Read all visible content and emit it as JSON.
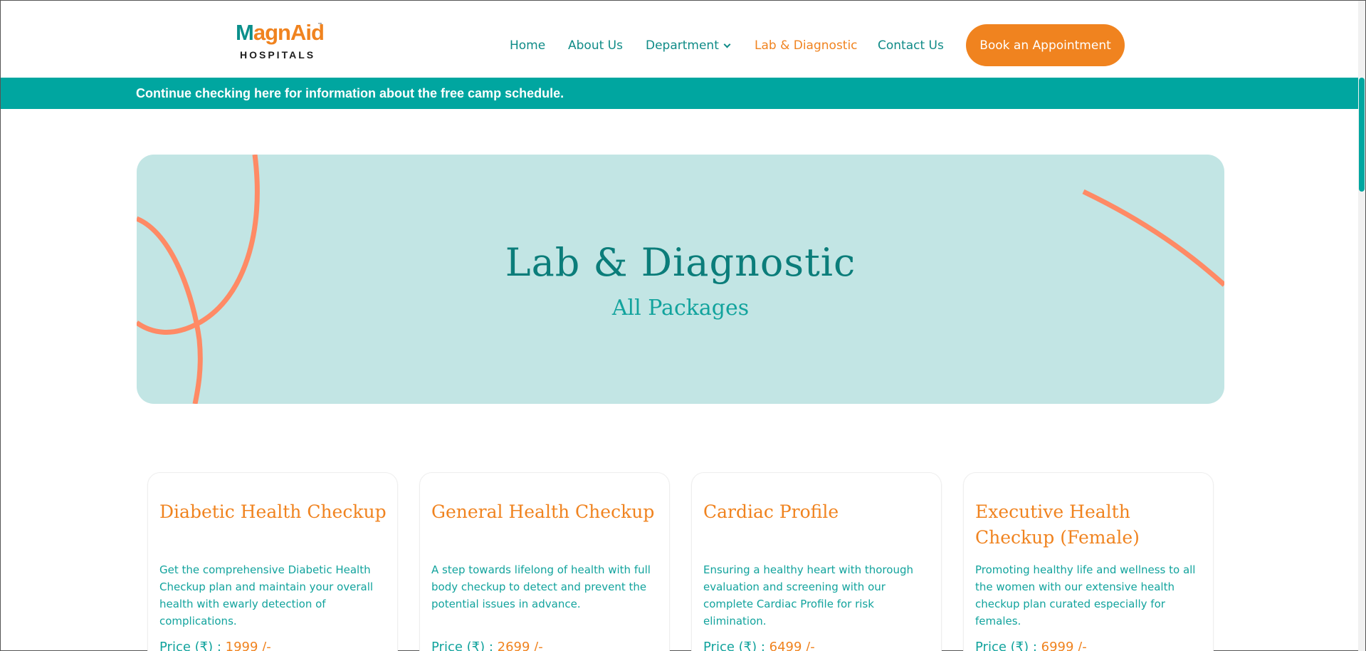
{
  "brand": {
    "logo_first_letter": "M",
    "logo_rest": "agnAid",
    "logo_tm": "™",
    "logo_sub": "HOSPITALS"
  },
  "nav": {
    "items": [
      {
        "label": "Home"
      },
      {
        "label": "About Us"
      },
      {
        "label": "Department"
      },
      {
        "label": "Lab & Diagnostic"
      },
      {
        "label": "Contact Us"
      }
    ],
    "active": "Lab & Diagnostic",
    "cta": "Book an Appointment"
  },
  "notice": {
    "text": "Continue checking here for information about the free camp schedule."
  },
  "hero": {
    "title": "Lab & Diagnostic",
    "subtitle": "All Packages"
  },
  "packages": [
    {
      "title": "Diabetic Health Checkup",
      "description": "Get the comprehensive Diabetic Health Checkup plan and maintain your overall health with ewarly detection of complications.",
      "price_label": "Price (₹) : ",
      "price": "1999 /-"
    },
    {
      "title": "General Health Checkup",
      "description": "A step towards lifelong of health with full body checkup to detect and prevent the potential issues in advance.",
      "price_label": "Price (₹) : ",
      "price": "2699 /-"
    },
    {
      "title": "Cardiac Profile",
      "description": "Ensuring a healthy heart with thorough evaluation and screening with our complete Cardiac Profile for risk elimination.",
      "price_label": "Price (₹) : ",
      "price": "6499 /-"
    },
    {
      "title": "Executive Health Checkup (Female)",
      "description": "Promoting healthy life and wellness to all the women with our extensive health checkup plan curated especially for females.",
      "price_label": "Price (₹) : ",
      "price": "6999 /-"
    }
  ],
  "colors": {
    "teal": "#00a6a0",
    "orange": "#f0831f",
    "hero_bg": "#c2e5e4",
    "hero_curve": "#ff8a65"
  }
}
